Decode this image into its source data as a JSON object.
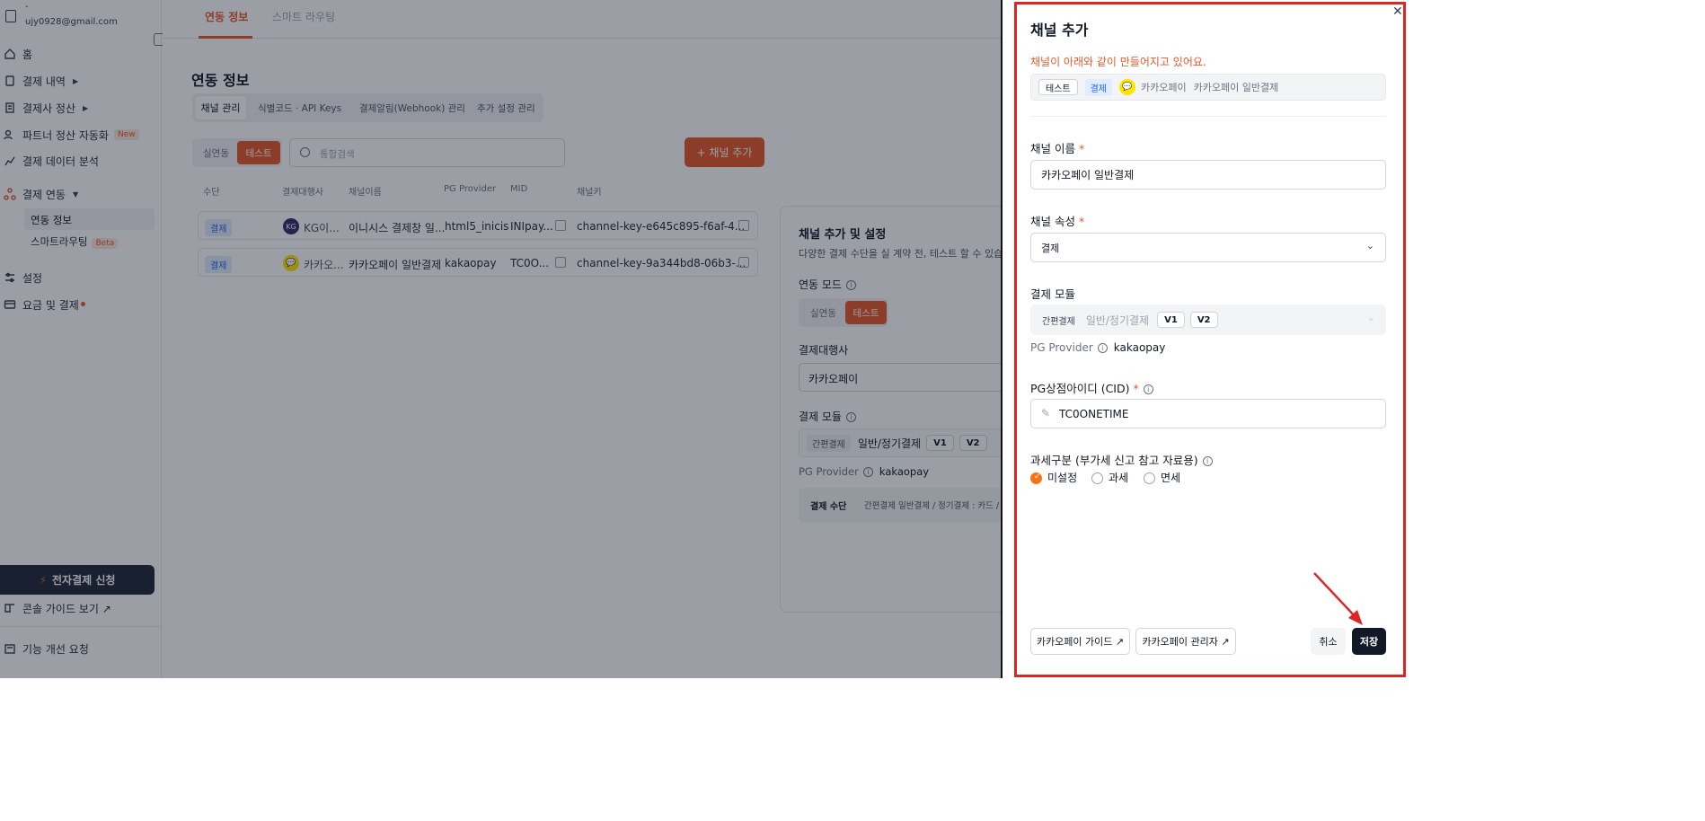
{
  "sidebar": {
    "account_name": "-",
    "account_email": "ujy0928@gmail.com",
    "items": [
      {
        "label": "홈"
      },
      {
        "label": "결제 내역"
      },
      {
        "label": "결제사 정산"
      },
      {
        "label": "파트너 정산 자동화",
        "badge": "New"
      },
      {
        "label": "결제 데이터 분석"
      },
      {
        "label": "결제 연동"
      },
      {
        "label": "연동 정보"
      },
      {
        "label": "스마트라우팅",
        "badge": "Beta"
      },
      {
        "label": "설정"
      },
      {
        "label": "요금 및 결제"
      }
    ],
    "apply_button": "전자결제 신청",
    "guide_link": "콘솔 가이드 보기 ↗",
    "feedback_link": "기능 개선 요청"
  },
  "main": {
    "top_tabs": [
      "연동 정보",
      "스마트 라우팅"
    ],
    "page_title": "연동 정보",
    "sub_tabs": [
      "채널 관리",
      "식별코드 · API Keys",
      "결제알림(Webhook) 관리",
      "추가 설정 관리"
    ],
    "mode_toggle": [
      "실연동",
      "테스트"
    ],
    "search_placeholder": "통합검색",
    "add_channel_button": "+ 채널 추가",
    "table_headers": [
      "수단",
      "결제대행사",
      "채널이름",
      "PG Provider",
      "MID",
      "채널키"
    ],
    "rows": [
      {
        "type": "결제",
        "logo": "KG",
        "pg": "KG이...",
        "name": "이니시스 결제창 일...",
        "provider": "html5_inicis",
        "mid": "INIpay...",
        "key": "channel-key-e645c895-f6af-4..."
      },
      {
        "type": "결제",
        "logo": "💬",
        "pg": "카카오...",
        "name": "카카오페이 일반결제",
        "provider": "kakaopay",
        "mid": "TC0O...",
        "key": "channel-key-9a344bd8-06b3-..."
      }
    ],
    "detail": {
      "title": "채널 추가 및 설정",
      "desc": "다양한 결제 수단을 실 계약 전, 테스트 할 수 있습니",
      "mode_label": "연동 모드",
      "mode_options": [
        "실연동",
        "테스트"
      ],
      "pg_label": "결제대행사",
      "pg_value": "카카오페이",
      "module_label": "결제 모듈",
      "module_type": "간편결제",
      "module_value": "일반/정기결제",
      "module_versions": [
        "V1",
        "V2"
      ],
      "provider_label": "PG Provider",
      "provider_value": "kakaopay",
      "method_label": "결제 수단",
      "method_value": "간편결제 일반결제 / 정기결제 : 카드 / 카"
    }
  },
  "panel": {
    "title": "채널 추가",
    "notice": "채널이 아래와 같이 만들어지고 있어요.",
    "summary": {
      "tag_test": "테스트",
      "tag_pay": "결제",
      "pg": "카카오페이",
      "channel": "카카오페이 일반결제"
    },
    "name_label": "채널 이름",
    "name_value": "카카오페이 일반결제",
    "attr_label": "채널 속성",
    "attr_value": "결제",
    "module_label": "결제 모듈",
    "module_type": "간편결제",
    "module_value": "일반/정기결제",
    "module_versions": [
      "V1",
      "V2"
    ],
    "provider_label": "PG Provider",
    "provider_value": "kakaopay",
    "cid_label": "PG상점아이디 (CID)",
    "cid_value": "TC0ONETIME",
    "tax_label": "과세구분 (부가세 신고 참고 자료용)",
    "tax_options": [
      "미설정",
      "과세",
      "면세"
    ],
    "guide_button": "카카오페이 가이드 ↗",
    "admin_button": "카카오페이 관리자 ↗",
    "cancel_button": "취소",
    "save_button": "저장"
  },
  "colors": {
    "accent": "#e5582b",
    "dark": "#1f2937",
    "annotation": "#dc2626"
  }
}
